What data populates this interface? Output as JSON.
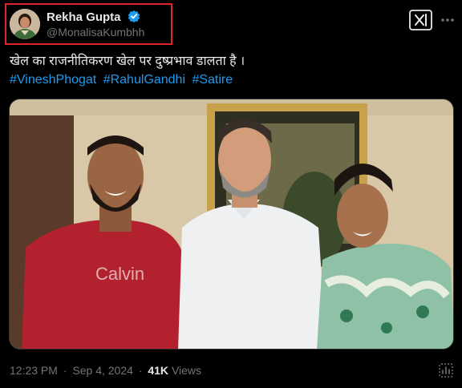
{
  "author": {
    "display_name": "Rekha Gupta",
    "handle": "@MonalisaKumbhh"
  },
  "tweet": {
    "text": "खेल का राजनीतिकरण खेल पर दुष्प्रभाव डालता है ।",
    "hashtags": [
      "#VineshPhogat",
      "#RahulGandhi",
      "#Satire"
    ]
  },
  "meta": {
    "time": "12:23 PM",
    "separator": "·",
    "date": "Sep 4, 2024",
    "views_count": "41K",
    "views_label": "Views"
  },
  "media": {
    "shirt_text": "Calvin"
  },
  "colors": {
    "background": "#000000",
    "text": "#e7e9ea",
    "secondary": "#71767b",
    "link": "#1d9bf0",
    "highlight": "#e0242b"
  }
}
